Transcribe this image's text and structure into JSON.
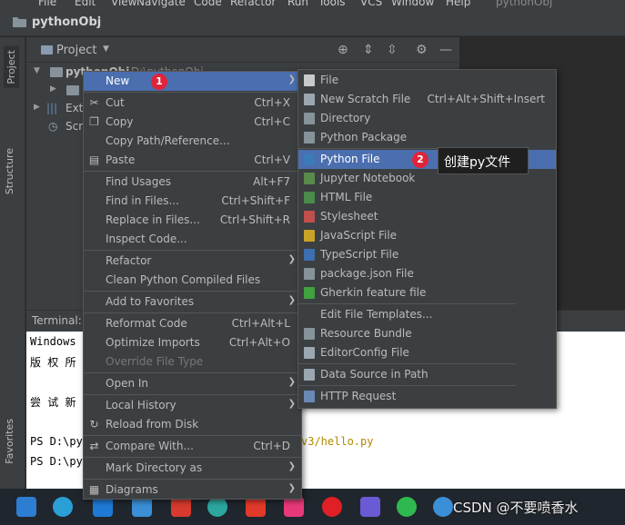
{
  "menubar": {
    "items": [
      "File",
      "Edit",
      "View",
      "Navigate",
      "Code",
      "Refactor",
      "Run",
      "Tools",
      "VCS",
      "Window",
      "Help"
    ],
    "window_title": "pythonObj"
  },
  "navbar": {
    "title": "pythonObj"
  },
  "sidebar_tabs": {
    "project": "Project",
    "structure": "Structure",
    "favorites": "Favorites"
  },
  "project_panel": {
    "title": "Project",
    "tree": [
      {
        "label": "pythonObj",
        "path": "D:\\pythonObj"
      },
      {
        "label": ""
      },
      {
        "label": "Exte"
      },
      {
        "label": "Scr"
      }
    ]
  },
  "terminal": {
    "label": "Terminal:",
    "lines": [
      "Windows",
      "版 权 所 有",
      "",
      "尝 试 新 的",
      "",
      "PS D:\\py",
      "PS D:\\py"
    ],
    "path_fragment": "v3/hello.py"
  },
  "context_menu": {
    "items": [
      {
        "label": "New",
        "submenu": true,
        "selected": true
      },
      {
        "sep": true
      },
      {
        "label": "Cut",
        "shortcut": "Ctrl+X",
        "icon": "scissors-icon"
      },
      {
        "label": "Copy",
        "shortcut": "Ctrl+C",
        "icon": "copy-icon"
      },
      {
        "label": "Copy Path/Reference..."
      },
      {
        "label": "Paste",
        "shortcut": "Ctrl+V",
        "icon": "paste-icon"
      },
      {
        "sep": true
      },
      {
        "label": "Find Usages",
        "shortcut": "Alt+F7"
      },
      {
        "label": "Find in Files...",
        "shortcut": "Ctrl+Shift+F"
      },
      {
        "label": "Replace in Files...",
        "shortcut": "Ctrl+Shift+R"
      },
      {
        "label": "Inspect Code..."
      },
      {
        "sep": true
      },
      {
        "label": "Refactor",
        "submenu": true
      },
      {
        "label": "Clean Python Compiled Files"
      },
      {
        "sep": true
      },
      {
        "label": "Add to Favorites",
        "submenu": true
      },
      {
        "sep": true
      },
      {
        "label": "Reformat Code",
        "shortcut": "Ctrl+Alt+L"
      },
      {
        "label": "Optimize Imports",
        "shortcut": "Ctrl+Alt+O"
      },
      {
        "label": "Override File Type",
        "disabled": true
      },
      {
        "sep": true
      },
      {
        "label": "Open In",
        "submenu": true
      },
      {
        "sep": true
      },
      {
        "label": "Local History",
        "submenu": true
      },
      {
        "label": "Reload from Disk",
        "icon": "reload-icon"
      },
      {
        "sep": true
      },
      {
        "label": "Compare With...",
        "shortcut": "Ctrl+D",
        "icon": "compare-icon"
      },
      {
        "sep": true
      },
      {
        "label": "Mark Directory as",
        "submenu": true
      },
      {
        "sep": true
      },
      {
        "label": "Diagrams",
        "submenu": true,
        "icon": "diagram-icon"
      }
    ]
  },
  "new_submenu": {
    "items": [
      {
        "label": "File",
        "icon": "file-icon",
        "color": "#c9c9c9"
      },
      {
        "label": "New Scratch File",
        "shortcut": "Ctrl+Alt+Shift+Insert",
        "icon": "scratch-icon",
        "color": "#9aa7b0"
      },
      {
        "label": "Directory",
        "icon": "folder-icon",
        "color": "#87939a"
      },
      {
        "label": "Python Package",
        "icon": "package-icon",
        "color": "#87939a"
      },
      {
        "sep": true
      },
      {
        "label": "Python File",
        "selected": true,
        "icon": "python-icon",
        "color": "#3d7ab8"
      },
      {
        "label": "Jupyter Notebook",
        "icon": "jupyter-icon",
        "color": "#5a8a4a"
      },
      {
        "label": "HTML File",
        "icon": "html-icon",
        "color": "#4a8a4a"
      },
      {
        "label": "Stylesheet",
        "icon": "css-icon",
        "color": "#c0504d"
      },
      {
        "label": "JavaScript File",
        "icon": "js-icon",
        "color": "#c9a227"
      },
      {
        "label": "TypeScript File",
        "icon": "ts-icon",
        "color": "#3d6fb0"
      },
      {
        "label": "package.json File",
        "icon": "npm-icon",
        "color": "#87939a"
      },
      {
        "label": "Gherkin feature file",
        "icon": "gherkin-icon",
        "color": "#3fa13f"
      },
      {
        "sep": true
      },
      {
        "label": "Edit File Templates...",
        "icon": "",
        "color": ""
      },
      {
        "label": "Resource Bundle",
        "icon": "bundle-icon",
        "color": "#87939a"
      },
      {
        "label": "EditorConfig File",
        "icon": "gear-icon",
        "color": "#9aa7b0"
      },
      {
        "sep": true
      },
      {
        "label": "Data Source in Path",
        "icon": "database-icon",
        "color": "#9aa7b0"
      },
      {
        "sep": true
      },
      {
        "label": "HTTP Request",
        "icon": "api-icon",
        "color": "#6a89b5"
      }
    ]
  },
  "annotations": {
    "badge1": "1",
    "badge2": "2",
    "tooltip": "创建py文件"
  },
  "taskbar": {
    "watermark": "CSDN @不要喷香水"
  }
}
